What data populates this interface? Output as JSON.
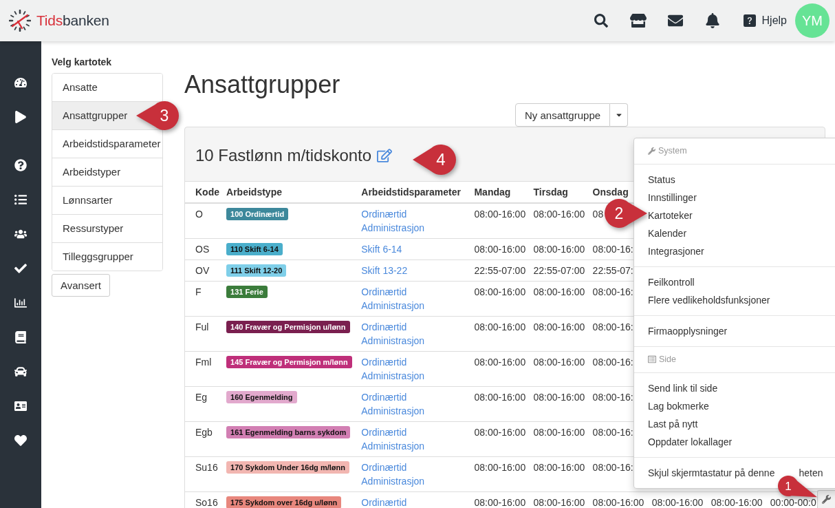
{
  "header": {
    "logo": [
      {
        "text": "Tids",
        "color": "#d8303a"
      },
      {
        "text": "banken",
        "color": "#2b3540"
      }
    ],
    "help": "Hjelp",
    "avatar": "YM"
  },
  "kartotek": {
    "title": "Velg kartotek",
    "items": [
      {
        "label": "Ansatte",
        "selected": false
      },
      {
        "label": "Ansattgrupper",
        "selected": true
      },
      {
        "label": "Arbeidstidsparameter",
        "selected": false
      },
      {
        "label": "Arbeidstyper",
        "selected": false
      },
      {
        "label": "Lønnsarter",
        "selected": false
      },
      {
        "label": "Ressurstyper",
        "selected": false
      },
      {
        "label": "Tilleggsgrupper",
        "selected": false
      }
    ],
    "button": "Avansert"
  },
  "page": {
    "title": "Ansattgrupper",
    "new_button": "Ny ansattgruppe"
  },
  "panel": {
    "title": "10 Fastlønn m/tidskonto"
  },
  "table": {
    "columns": [
      "Kode",
      "Arbeidstype",
      "Arbeidstidsparameter",
      "Mandag",
      "Tirsdag",
      "Onsdag"
    ],
    "rows": [
      {
        "kode": "O",
        "arbeidstype": {
          "label": "100 Ordinærtid",
          "color": "#3d889b"
        },
        "parameters": [
          "Ordinærtid",
          "Administrasjon"
        ],
        "days": [
          "08:00-16:00",
          "08:00-16:00",
          "08"
        ]
      },
      {
        "kode": "OS",
        "arbeidstype": {
          "label": "110 Skift 6-14",
          "color": "#4aaecb"
        },
        "parameters": [
          "Skift 6-14"
        ],
        "days": [
          "08:00-16:00",
          "08:00-16:00",
          "08:00-16:"
        ]
      },
      {
        "kode": "OV",
        "arbeidstype": {
          "label": "111 Skift 12-20",
          "color": "#7fcfe9"
        },
        "parameters": [
          "Skift 13-22"
        ],
        "days": [
          "22:55-07:00",
          "22:55-07:00",
          "22:55-07:"
        ]
      },
      {
        "kode": "F",
        "arbeidstype": {
          "label": "131 Ferie",
          "color": "#3b7c3b"
        },
        "parameters": [
          "Ordinærtid",
          "Administrasjon"
        ],
        "days": [
          "08:00-16:00",
          "08:00-16:00",
          "08:00-16:"
        ]
      },
      {
        "kode": "Ful",
        "arbeidstype": {
          "label": "140 Fravær og Permisjon u/lønn",
          "color": "#7a1f4f"
        },
        "parameters": [
          "Ordinærtid",
          "Administrasjon"
        ],
        "days": [
          "08:00-16:00",
          "08:00-16:00",
          "08:00-16:"
        ]
      },
      {
        "kode": "Fml",
        "arbeidstype": {
          "label": "145 Fravær og Permisjon m/lønn",
          "color": "#bf2f7a"
        },
        "parameters": [
          "Ordinærtid",
          "Administrasjon"
        ],
        "days": [
          "08:00-16:00",
          "08:00-16:00",
          "08:00-16:"
        ]
      },
      {
        "kode": "Eg",
        "arbeidstype": {
          "label": "160 Egenmelding",
          "color": "#e2a9cd"
        },
        "parameters": [
          "Ordinærtid",
          "Administrasjon"
        ],
        "days": [
          "08:00-16:00",
          "08:00-16:00",
          "08:00-16:"
        ]
      },
      {
        "kode": "Egb",
        "arbeidstype": {
          "label": "161 Egenmelding barns sykdom",
          "color": "#d27fb3"
        },
        "parameters": [
          "Ordinærtid",
          "Administrasjon"
        ],
        "days": [
          "08:00-16:00",
          "08:00-16:00",
          "08:00-16:"
        ]
      },
      {
        "kode": "Su16",
        "arbeidstype": {
          "label": "170 Sykdom Under 16dg m/lønn",
          "color": "#f2b6b1"
        },
        "parameters": [
          "Ordinærtid",
          "Administrasjon"
        ],
        "days": [
          "08:00-16:00",
          "08:00-16:00",
          "08:00-16:"
        ]
      },
      {
        "kode": "So16",
        "arbeidstype": {
          "label": "175 Sykdom over 16dg u/lønn",
          "color": "#e8877d"
        },
        "parameters": [
          "Ordinærtid"
        ],
        "days": [
          "08:00-16:00",
          "08:00-16:00",
          "08:00-16:00",
          "08:00-16:00",
          "08:00-16:00",
          "00:00-00:0"
        ]
      }
    ]
  },
  "menu": {
    "groups": [
      {
        "kind": "header",
        "label": "System"
      },
      {
        "kind": "items",
        "items": [
          {
            "label": "Status"
          },
          {
            "label": "Innstillinger"
          },
          {
            "label": "Kartoteker"
          },
          {
            "label": "Kalender"
          },
          {
            "label": "Integrasjoner"
          }
        ]
      },
      {
        "kind": "items",
        "items": [
          {
            "label": "Feilkontroll"
          },
          {
            "label": "Flere vedlikeholdsfunksjoner"
          }
        ]
      },
      {
        "kind": "items",
        "items": [
          {
            "label": "Firmaopplysninger"
          }
        ]
      },
      {
        "kind": "header",
        "label": "Side"
      },
      {
        "kind": "items",
        "items": [
          {
            "label": "Send link til side"
          },
          {
            "label": "Lag bokmerke"
          },
          {
            "label": "Last på nytt"
          },
          {
            "label": "Oppdater lokallager"
          }
        ]
      },
      {
        "kind": "items",
        "items": [
          {
            "label": "Skjul skjermtastatur på denne",
            "rest": "heten"
          }
        ]
      }
    ]
  },
  "callouts": [
    {
      "number": "1"
    },
    {
      "number": "2"
    },
    {
      "number": "3"
    },
    {
      "number": "4"
    }
  ]
}
